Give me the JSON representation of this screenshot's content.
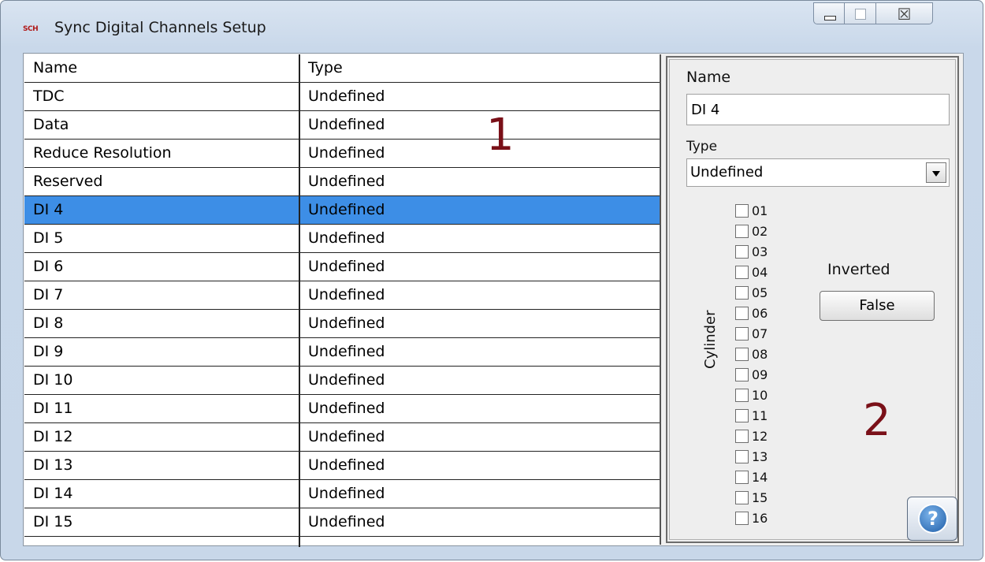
{
  "window": {
    "title": "Sync Digital Channels Setup",
    "app_icon": "SCH",
    "close_glyph": "☒"
  },
  "table": {
    "headers": {
      "name": "Name",
      "type": "Type"
    },
    "rows": [
      {
        "name": "TDC",
        "type": "Undefined"
      },
      {
        "name": "Data",
        "type": "Undefined"
      },
      {
        "name": "Reduce Resolution",
        "type": "Undefined"
      },
      {
        "name": "Reserved",
        "type": "Undefined"
      },
      {
        "name": "DI 4",
        "type": "Undefined"
      },
      {
        "name": "DI 5",
        "type": "Undefined"
      },
      {
        "name": "DI 6",
        "type": "Undefined"
      },
      {
        "name": "DI 7",
        "type": "Undefined"
      },
      {
        "name": "DI 8",
        "type": "Undefined"
      },
      {
        "name": "DI 9",
        "type": "Undefined"
      },
      {
        "name": "DI 10",
        "type": "Undefined"
      },
      {
        "name": "DI 11",
        "type": "Undefined"
      },
      {
        "name": "DI 12",
        "type": "Undefined"
      },
      {
        "name": "DI 13",
        "type": "Undefined"
      },
      {
        "name": "DI 14",
        "type": "Undefined"
      },
      {
        "name": "DI 15",
        "type": "Undefined"
      }
    ],
    "selected_index": 4,
    "annotation": "1"
  },
  "panel": {
    "name_label": "Name",
    "name_value": "DI 4",
    "type_label": "Type",
    "type_value": "Undefined",
    "cylinder_label": "Cylinder",
    "cylinders": [
      "01",
      "02",
      "03",
      "04",
      "05",
      "06",
      "07",
      "08",
      "09",
      "10",
      "11",
      "12",
      "13",
      "14",
      "15",
      "16"
    ],
    "inverted_label": "Inverted",
    "inverted_value": "False",
    "help_glyph": "?",
    "annotation": "2"
  },
  "colors": {
    "selection": "#3d8ee6",
    "annotation": "#7a1018"
  }
}
